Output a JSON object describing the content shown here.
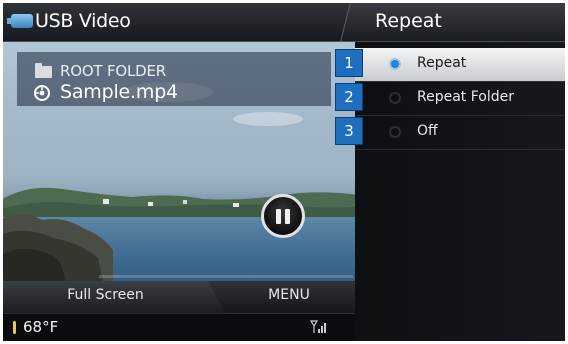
{
  "header": {
    "title": "USB Video"
  },
  "player": {
    "folder": "ROOT FOLDER",
    "file": "Sample.mp4",
    "progress_fraction": 0.0
  },
  "bottom": {
    "fullscreen_label": "Full Screen",
    "menu_label": "MENU",
    "temperature": "68°F"
  },
  "repeat_panel": {
    "title": "Repeat",
    "options": [
      {
        "badge": "1",
        "label": "Repeat",
        "selected": true
      },
      {
        "badge": "2",
        "label": "Repeat Folder",
        "selected": false
      },
      {
        "badge": "3",
        "label": "Off",
        "selected": false
      }
    ]
  },
  "colors": {
    "accent_blue": "#1f6fc0",
    "selected_radio": "#2c88d9",
    "selected_row": "#e9eaec"
  },
  "icons": [
    "usb-icon",
    "folder-icon",
    "file-icon",
    "pause-icon",
    "thermometer-icon",
    "signal-icon"
  ]
}
